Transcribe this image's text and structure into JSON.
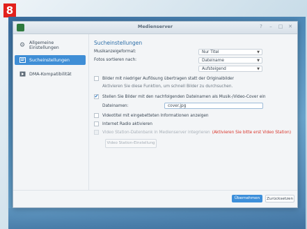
{
  "badge": "8",
  "window": {
    "title": "Medienserver",
    "controls": [
      "?",
      "–",
      "□",
      "✕"
    ]
  },
  "sidebar": {
    "items": [
      {
        "label_line1": "Allgemeine",
        "label_line2": "Einstellungen",
        "icon": "gear-icon",
        "active": false
      },
      {
        "label": "Sucheinstellungen",
        "icon": "search-settings-icon",
        "active": true
      },
      {
        "label": "DMA-Kompatibilität",
        "icon": "dma-icon",
        "active": false
      }
    ]
  },
  "content": {
    "section_title": "Sucheinstellungen",
    "music_format_label": "Musikanzeigeformat:",
    "music_format_value": "Nur Titel",
    "photo_sort_label": "Fotos sortieren nach:",
    "photo_sort_value": "Dateiname",
    "order_value": "Aufsteigend",
    "opt_low_res": "Bilder mit niedriger Auflösung übertragen statt der Originalbilder",
    "opt_low_res_hint": "Aktivieren Sie diese Funktion, um schnell Bilder zu durchsuchen.",
    "opt_cover": "Stellen Sie Bilder mit den nachfolgenden Dateinamen als Musik-/Video-Cover ein",
    "filename_label": "Dateinamen:",
    "filename_value": "cover.jpg",
    "opt_video_thumbs": "Videotitel mit eingebetteten Informationen anzeigen",
    "opt_internet_radio": "Internet Radio aktivieren",
    "opt_video_station": "Video Station-Datenbank in Medienserver integrieren",
    "opt_video_station_warn": "(Aktivieren Sie bitte erst Video Station)",
    "video_station_button": "Video Station-Einstellung"
  },
  "footer": {
    "apply_label": "Übernehmen",
    "reset_label": "Zurücksetzen"
  }
}
